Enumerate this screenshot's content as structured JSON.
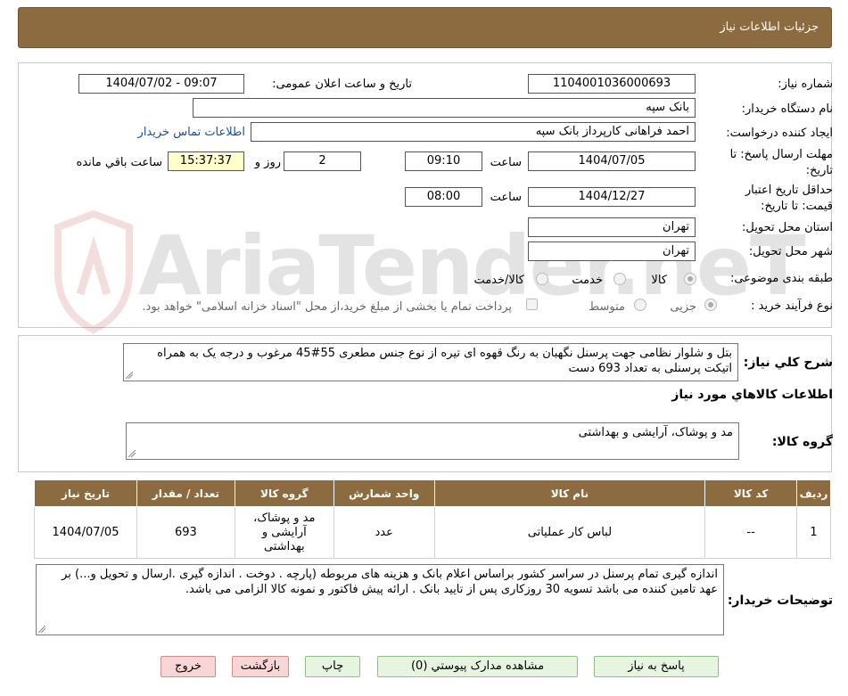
{
  "header": {
    "title": "جزئیات اطلاعات نیاز"
  },
  "form": {
    "need_number_label": "شماره نیاز:",
    "need_number": "1104001036000693",
    "announce_label": "تاریخ و ساعت اعلان عمومی:",
    "announce_value": "1404/07/02 - 09:07",
    "buyer_org_label": "نام دستگاه خریدار:",
    "buyer_org": "بانک سپه",
    "creator_label": "ایجاد کننده درخواست:",
    "creator": "احمد فراهانی کارپرداز بانک سپه",
    "contact_link": "اطلاعات تماس خریدار",
    "deadline_label_1": "مهلت ارسال پاسخ: تا",
    "deadline_label_2": "تاریخ:",
    "deadline_date": "1404/07/05",
    "hour_label": "ساعت",
    "deadline_time": "09:10",
    "days_value": "2",
    "days_label": "روز و",
    "remaining_time": "15:37:37",
    "remaining_label": "ساعت باقي مانده",
    "validity_label_1": "حداقل تاریخ اعتبار",
    "validity_label_2": "قیمت: تا تاریخ:",
    "validity_date": "1404/12/27",
    "validity_time": "08:00",
    "province_label": "استان محل تحویل:",
    "province": "تهران",
    "city_label": "شهر محل تحویل:",
    "city": "تهران",
    "category_label": "طبقه بندی موضوعی:",
    "category_options": [
      "کالا",
      "خدمت",
      "کالا/خدمت"
    ],
    "process_label": "نوع فرآیند خرید :",
    "process_options": [
      "جزیی",
      "متوسط"
    ],
    "payment_note": "پرداخت تمام یا بخشی از مبلغ خرید،از محل \"اسناد خزانه اسلامی\" خواهد بود."
  },
  "summary": {
    "label": "شرح کلي نياز:",
    "text": "بتل و شلوار نظامی جهت پرسنل نگهبان به رنگ قهوه ای تیره از نوع جنس مطعری 55#45 مرغوب و درجه یک به همراه اتیکت پرسنلی به تعداد 693 دست"
  },
  "goods": {
    "section_title": "اطلاعات کالاهاي مورد نياز",
    "group_label": "گروه کالا:",
    "group_value": "مد و پوشاک، آرایشی و بهداشتی",
    "columns": [
      "رديف",
      "کد کالا",
      "نام کالا",
      "واحد شمارش",
      "گروه کالا",
      "تعداد / مقدار",
      "تاريخ نياز"
    ],
    "rows": [
      [
        "1",
        "--",
        "لباس کار عملیاتی",
        "عدد",
        "مد و پوشاک، آرایشی و بهداشتی",
        "693",
        "1404/07/05"
      ]
    ]
  },
  "buyer_notes": {
    "label": "توضیحات خریدار:",
    "text": "اندازه گیری تمام پرسنل در سراسر کشور براساس اعلام بانک و هزینه های مربوطه (پارچه . دوخت . اندازه گیری .ارسال و تحویل و...) بر عهد تامین کننده می باشد تسویه 30 روزکاری پس از تایید بانک . ارائه پیش فاکتور و نمونه کالا الزامی می باشد."
  },
  "buttons": {
    "reply": "پاسخ به نیاز",
    "attachments": "مشاهده مدارک پیوستي (0)",
    "print": "چاپ",
    "back": "بازگشت",
    "exit": "خروج"
  },
  "watermark": {
    "text": "AriaTender.neT"
  }
}
